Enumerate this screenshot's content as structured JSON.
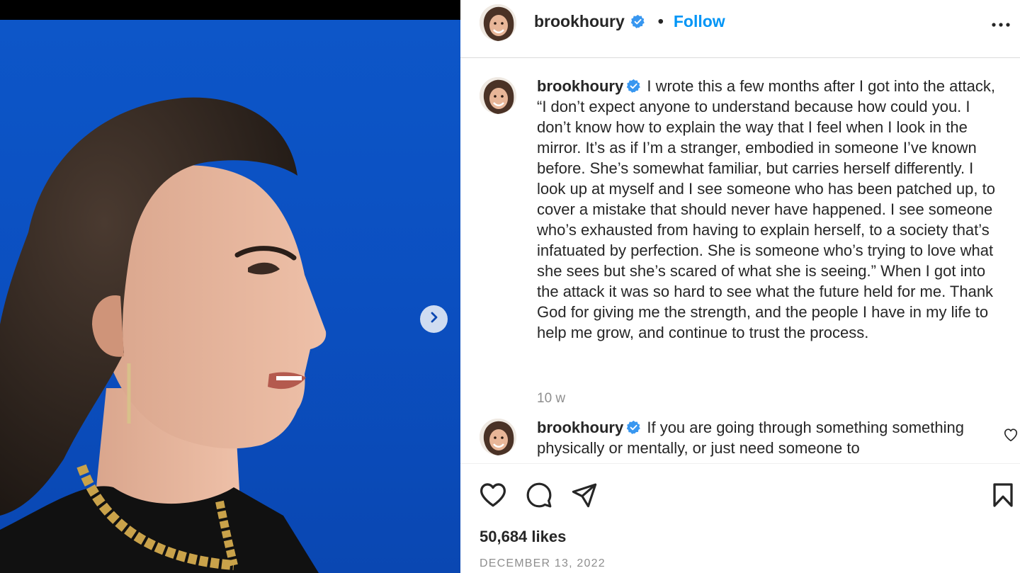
{
  "post": {
    "username": "brookhoury",
    "header_separator": "•",
    "follow_label": "Follow",
    "more_icon": "more-options-icon"
  },
  "comments": [
    {
      "username": "brookhoury",
      "text": "I wrote this a few months after I got into the attack, “I don’t expect anyone to understand because how could you. I don’t know how to explain the way that I feel when I look in the mirror. It’s as if I’m a stranger, embodied in someone I’ve known before. She’s somewhat familiar, but carries herself differently. I look up at myself and I see someone who has been patched up, to cover a mistake that should never have happened. I see someone who’s exhausted from having to explain herself, to a society that’s infatuated by perfection. She is someone who’s trying to love what she sees but she’s scared of what she is seeing.” When I got into the attack it was so hard to see what the future held for me. Thank God for giving me the strength, and the people I have in my life to help me grow, and continue to trust the process.",
      "time": "10 w"
    },
    {
      "username": "brookhoury",
      "text": "If you are going through something something physically or mentally, or just need someone to"
    }
  ],
  "actions": {
    "icons": [
      "heart-icon",
      "comment-icon",
      "share-icon",
      "bookmark-icon"
    ],
    "likes": "50,684 likes",
    "date": "DECEMBER 13, 2022"
  },
  "colors": {
    "accent": "#0095f6",
    "verified": "#3897f0",
    "photo_background": "#0b4fc0",
    "secondary_text": "#8e8e8e"
  }
}
